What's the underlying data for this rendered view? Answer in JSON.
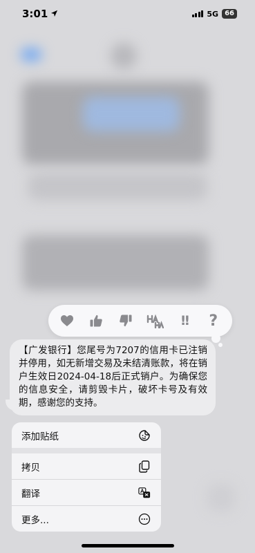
{
  "status_bar": {
    "time": "3:01",
    "network": "5G",
    "battery": "66"
  },
  "tapback": {
    "question": "?",
    "exclaim": "!!"
  },
  "message": {
    "text": "【广发银行】您尾号为7207的信用卡已注销并停用，如无新增交易及未结清账款，将在销户生效日2024-04-18后正式销户。为确保您的信息安全，请剪毁卡片，破坏卡号及有效期，感谢您的支持。"
  },
  "menu": {
    "items": [
      {
        "label": "添加贴纸",
        "icon": "sticker-icon"
      },
      {
        "label": "拷贝",
        "icon": "copy-icon"
      },
      {
        "label": "翻译",
        "icon": "translate-icon"
      },
      {
        "label": "更多...",
        "icon": "more-icon"
      }
    ]
  },
  "colors": {
    "background": "#d9d9dc",
    "bubble": "#ececee",
    "menu": "#f4f4f6",
    "tapback_icon": "#8a8a8e"
  }
}
